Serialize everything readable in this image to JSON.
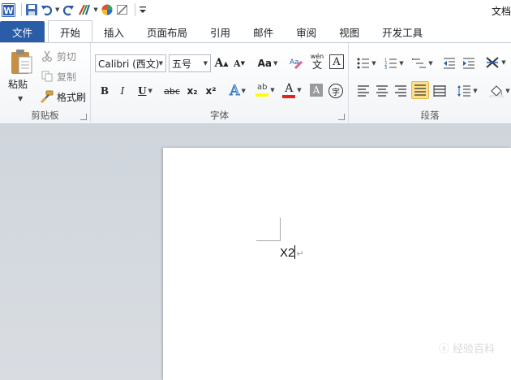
{
  "window": {
    "title": "文档"
  },
  "tabs": [
    {
      "label": "文件"
    },
    {
      "label": "开始"
    },
    {
      "label": "插入"
    },
    {
      "label": "页面布局"
    },
    {
      "label": "引用"
    },
    {
      "label": "邮件"
    },
    {
      "label": "审阅"
    },
    {
      "label": "视图"
    },
    {
      "label": "开发工具"
    }
  ],
  "clipboard": {
    "paste": "粘贴",
    "cut": "剪切",
    "copy": "复制",
    "format_painter": "格式刷",
    "label": "剪贴板"
  },
  "font": {
    "family": "Calibri (西文)",
    "size": "五号",
    "grow": "A",
    "shrink": "A",
    "case": "Aa",
    "wen": "wén",
    "wen_char": "文",
    "border_char": "A",
    "bold": "B",
    "italic": "I",
    "underline": "U",
    "strike": "abc",
    "subscript": "x₂",
    "superscript": "x²",
    "effects": "A",
    "highlight": "ab",
    "color": "A",
    "shading": "A",
    "circle_char": "字",
    "label": "字体"
  },
  "paragraph": {
    "label": "段落"
  },
  "colors": {
    "file_tab": "#2a5ca8",
    "highlight": "#ffff00",
    "font_color": "#e2231a",
    "selected": "#fce08c"
  },
  "document": {
    "text": "X2",
    "watermark": "ⓢ 经验百科"
  }
}
